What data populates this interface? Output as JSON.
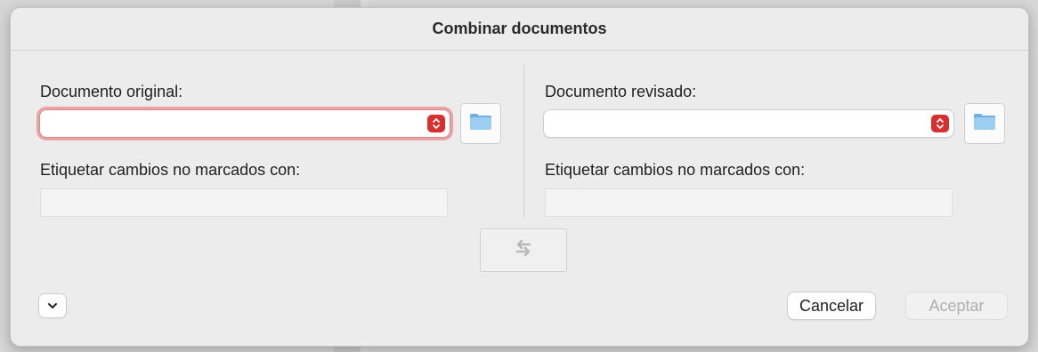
{
  "dialog": {
    "title": "Combinar documentos"
  },
  "original": {
    "label": "Documento original:",
    "value": "",
    "tag_label": "Etiquetar cambios no marcados con:",
    "tag_value": ""
  },
  "revised": {
    "label": "Documento revisado:",
    "value": "",
    "tag_label": "Etiquetar cambios no marcados con:",
    "tag_value": ""
  },
  "buttons": {
    "cancel": "Cancelar",
    "accept": "Aceptar"
  },
  "icons": {
    "stepper": "up-down-chevron-icon",
    "folder": "folder-icon",
    "swap": "swap-arrows-icon",
    "expand": "chevron-down-icon"
  },
  "colors": {
    "stepper": "#d63030",
    "focus_ring": "#eaa2a2",
    "folder": "#8fc3ec"
  }
}
